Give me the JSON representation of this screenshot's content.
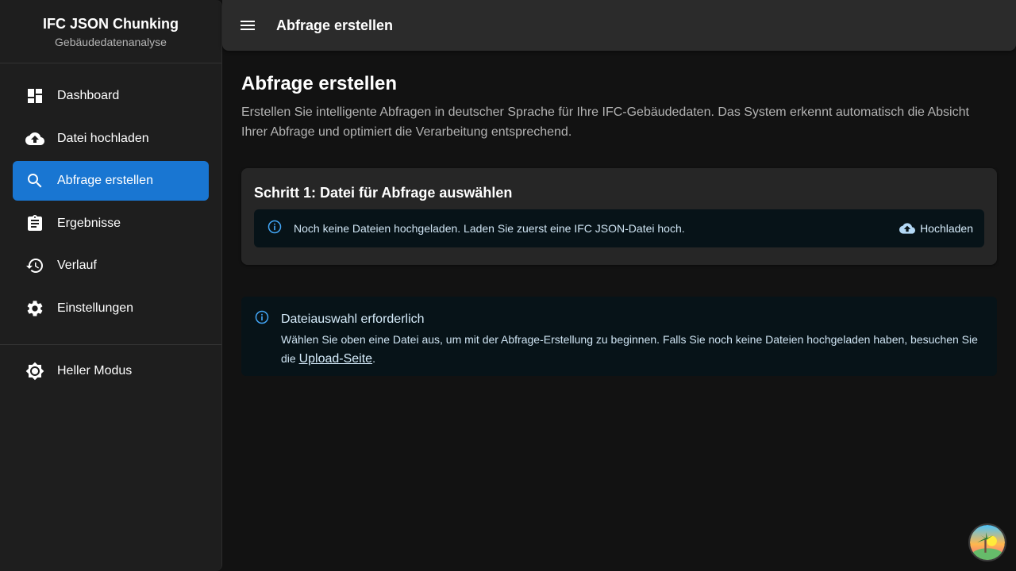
{
  "sidebar": {
    "brand_title": "IFC JSON Chunking",
    "brand_subtitle": "Gebäudedatenanalyse",
    "items": [
      {
        "label": "Dashboard",
        "icon": "dashboard-icon"
      },
      {
        "label": "Datei hochladen",
        "icon": "cloud-upload-icon"
      },
      {
        "label": "Abfrage erstellen",
        "icon": "search-icon",
        "active": true
      },
      {
        "label": "Ergebnisse",
        "icon": "assignment-icon"
      },
      {
        "label": "Verlauf",
        "icon": "history-icon"
      },
      {
        "label": "Einstellungen",
        "icon": "gear-icon"
      }
    ],
    "theme_toggle_label": "Heller Modus",
    "active_color": "#1976d2"
  },
  "appbar": {
    "title": "Abfrage erstellen"
  },
  "main": {
    "title": "Abfrage erstellen",
    "description": "Erstellen Sie intelligente Abfragen in deutscher Sprache für Ihre IFC-Gebäudedaten. Das System erkennt automatisch die Absicht Ihrer Abfrage und optimiert die Verarbeitung entsprechend.",
    "step_card": {
      "title": "Schritt 1: Datei für Abfrage auswählen",
      "alert_text": "Noch keine Dateien hochgeladen. Laden Sie zuerst eine IFC JSON-Datei hoch.",
      "upload_button": "Hochladen"
    },
    "info_alert": {
      "title": "Dateiauswahl erforderlich",
      "text_before": "Wählen Sie oben eine Datei aus, um mit der Abfrage-Erstellung zu beginnen. Falls Sie noch keine Dateien hochgeladen haben, besuchen Sie die ",
      "link": "Upload-Seite",
      "text_after": "."
    }
  },
  "colors": {
    "info": "#42a5f5",
    "background": "#121212",
    "sidebar": "#1e1e1e"
  }
}
